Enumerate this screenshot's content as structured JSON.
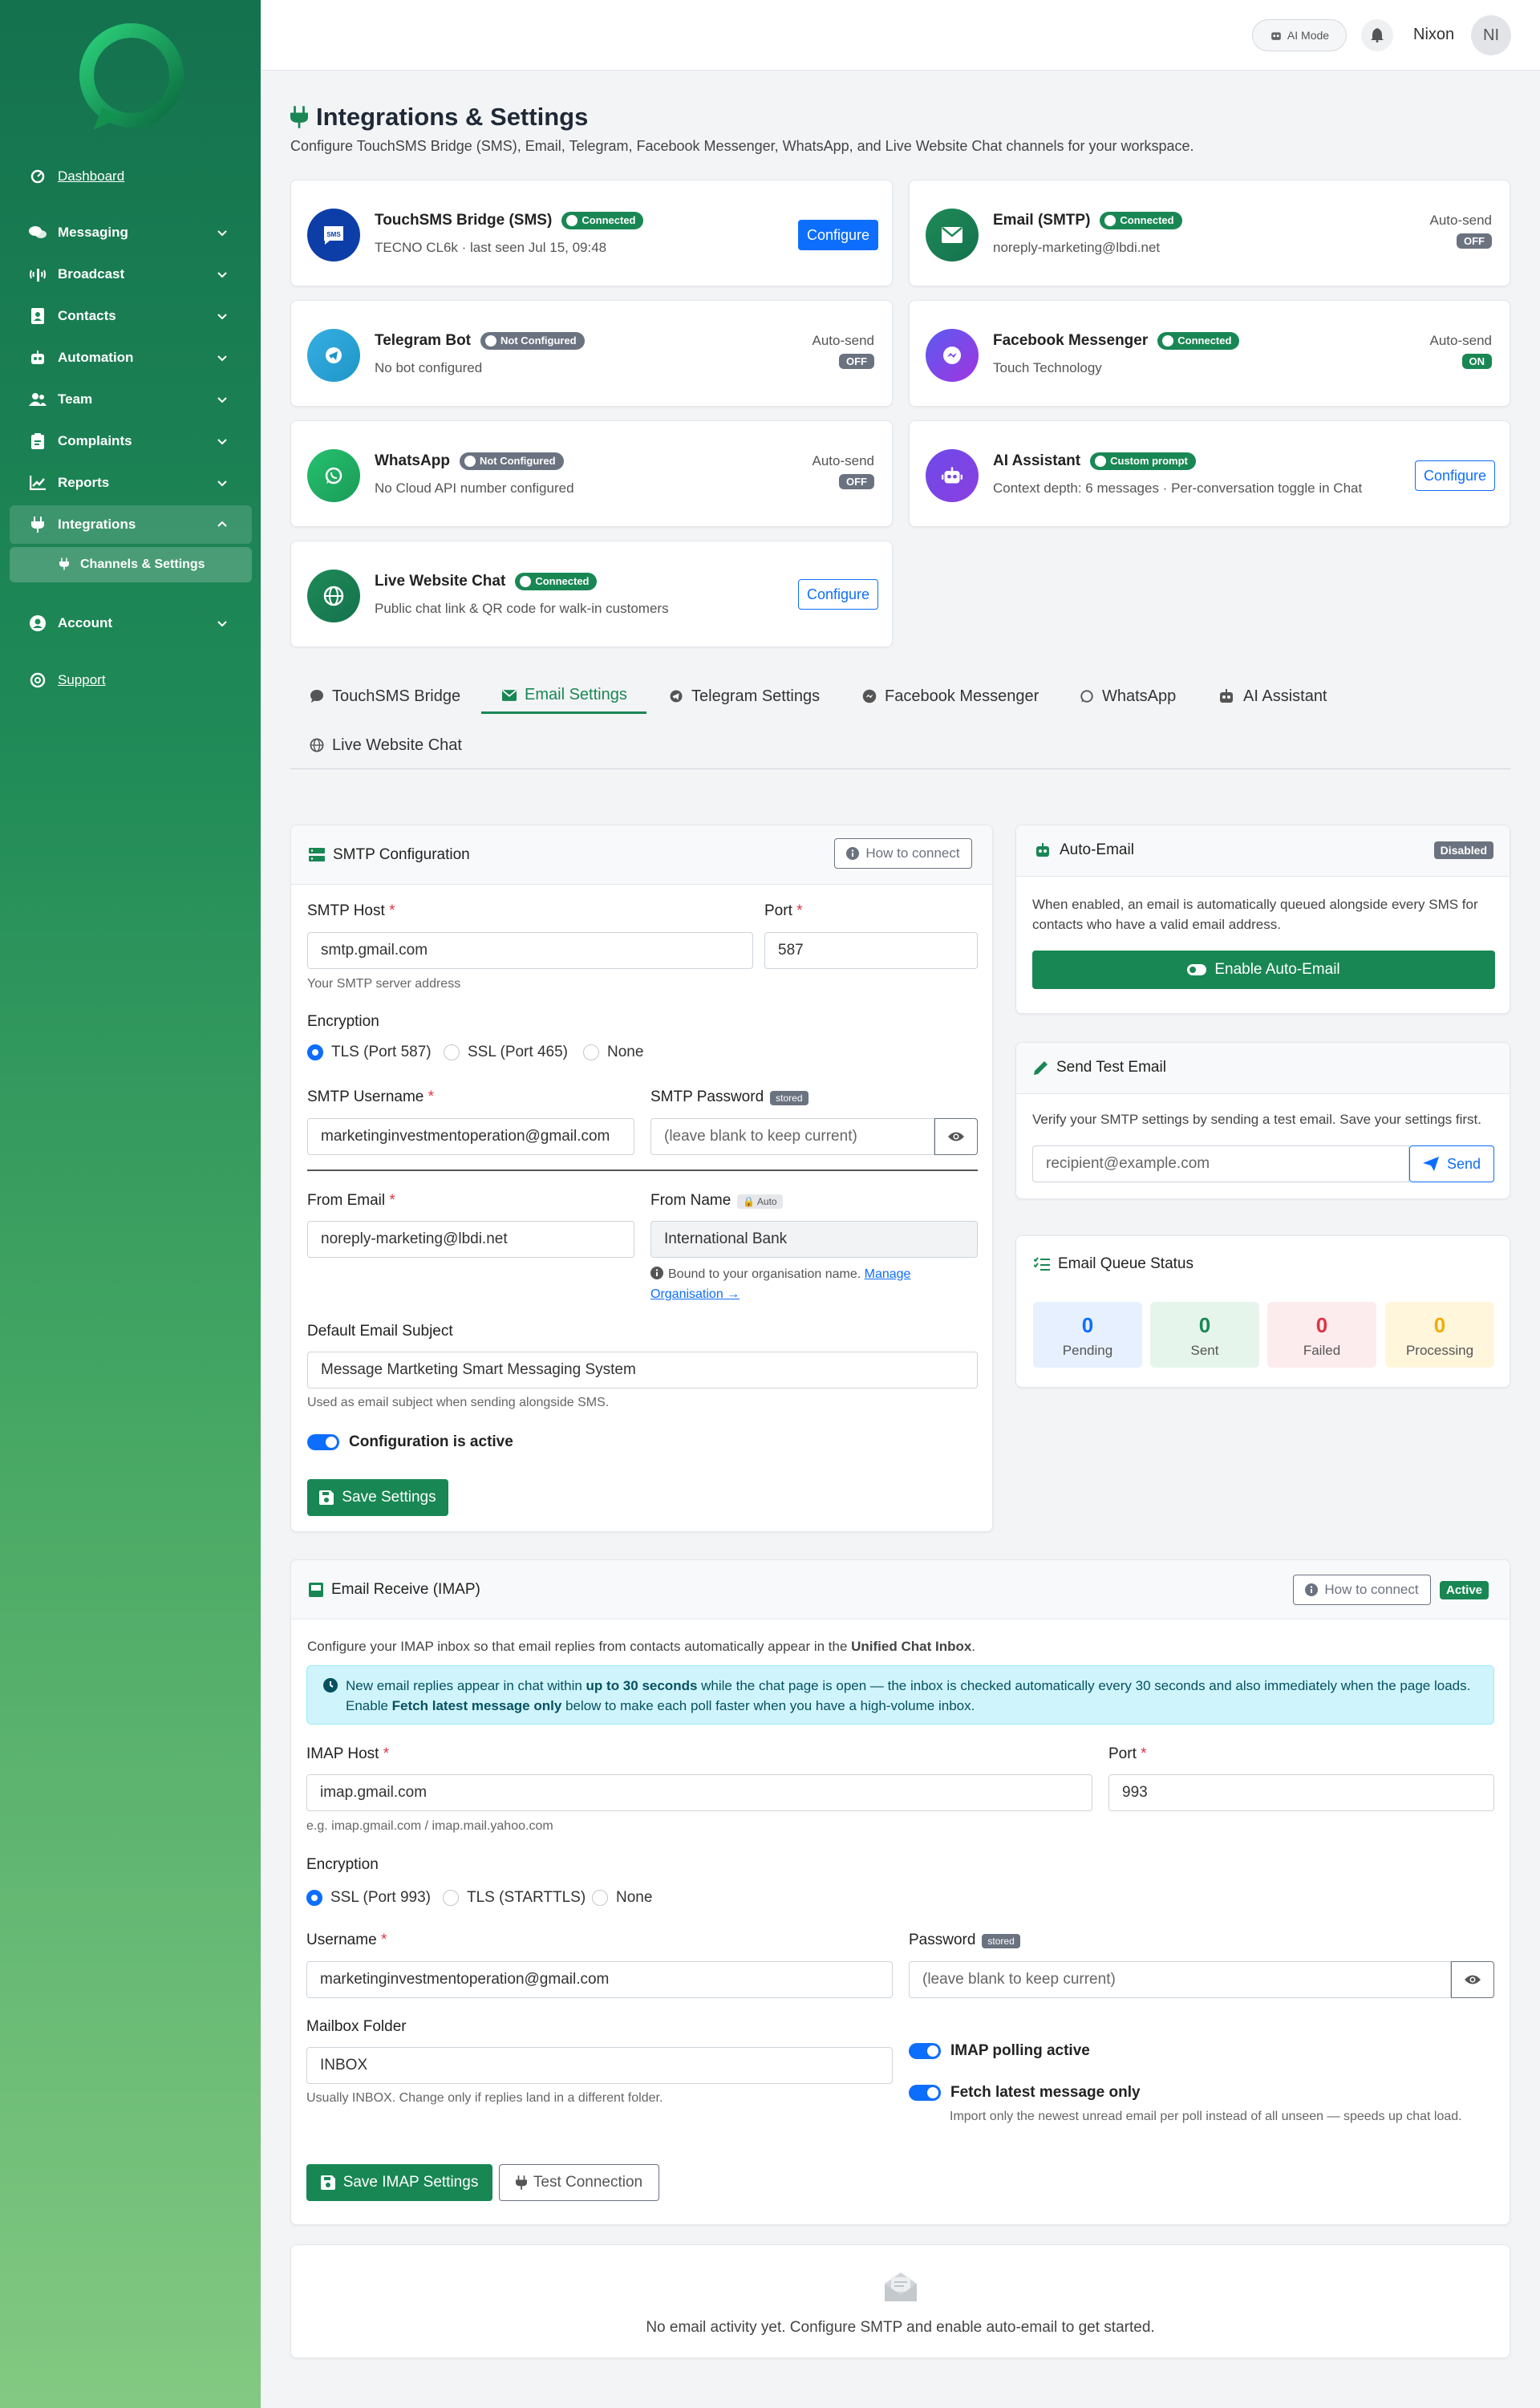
{
  "sidebar": {
    "dashboard": "Dashboard",
    "messaging": "Messaging",
    "broadcast": "Broadcast",
    "contacts": "Contacts",
    "automation": "Automation",
    "team": "Team",
    "complaints": "Complaints",
    "reports": "Reports",
    "integrations": "Integrations",
    "channels_settings": "Channels & Settings",
    "account": "Account",
    "support": "Support"
  },
  "topbar": {
    "ai_mode": "AI Mode",
    "user_name": "Nixon",
    "initials": "NI"
  },
  "page": {
    "title": "Integrations & Settings",
    "subtitle": "Configure TouchSMS Bridge (SMS), Email, Telegram, Facebook Messenger, WhatsApp, and Live Website Chat channels for your workspace."
  },
  "channels": {
    "sms": {
      "name": "TouchSMS Bridge (SMS)",
      "status": "Connected",
      "desc": "TECNO CL6k · last seen Jul 15, 09:48",
      "button": "Configure"
    },
    "email": {
      "name": "Email (SMTP)",
      "status": "Connected",
      "desc": "noreply-marketing@lbdi.net",
      "auto_label": "Auto-send",
      "auto_value": "OFF"
    },
    "telegram": {
      "name": "Telegram Bot",
      "status": "Not Configured",
      "desc": "No bot configured",
      "auto_label": "Auto-send",
      "auto_value": "OFF"
    },
    "facebook": {
      "name": "Facebook Messenger",
      "status": "Connected",
      "desc": "Touch Technology",
      "auto_label": "Auto-send",
      "auto_value": "ON"
    },
    "whatsapp": {
      "name": "WhatsApp",
      "status": "Not Configured",
      "desc": "No Cloud API number configured",
      "auto_label": "Auto-send",
      "auto_value": "OFF"
    },
    "ai": {
      "name": "AI Assistant",
      "status": "Custom prompt",
      "desc": "Context depth: 6 messages · Per-conversation toggle in Chat",
      "button": "Configure"
    },
    "livechat": {
      "name": "Live Website Chat",
      "status": "Connected",
      "desc": "Public chat link & QR code for walk-in customers",
      "button": "Configure"
    }
  },
  "tabs": {
    "sms": "TouchSMS Bridge",
    "email": "Email Settings",
    "telegram": "Telegram Settings",
    "facebook": "Facebook Messenger",
    "whatsapp": "WhatsApp",
    "ai": "AI Assistant",
    "livechat": "Live Website Chat"
  },
  "smtp": {
    "title": "SMTP Configuration",
    "how_to": "How to connect",
    "host_label": "SMTP Host",
    "host_value": "smtp.gmail.com",
    "host_hint": "Your SMTP server address",
    "port_label": "Port",
    "port_value": "587",
    "encryption_label": "Encryption",
    "enc_tls": "TLS (Port 587)",
    "enc_ssl": "SSL (Port 465)",
    "enc_none": "None",
    "username_label": "SMTP Username",
    "username_value": "marketinginvestmentoperation@gmail.com",
    "password_label": "SMTP Password",
    "password_badge": "stored",
    "password_placeholder": "(leave blank to keep current)",
    "from_email_label": "From Email",
    "from_email_value": "noreply-marketing@lbdi.net",
    "from_name_label": "From Name",
    "from_name_badge": "Auto",
    "from_name_value": "International Bank",
    "from_name_hint": "Bound to your organisation name.",
    "from_name_link": "Manage Organisation →",
    "subject_label": "Default Email Subject",
    "subject_value": "Message Martketing Smart Messaging System",
    "subject_hint": "Used as email subject when sending alongside SMS.",
    "active_label": "Configuration is active",
    "save": "Save Settings"
  },
  "auto_email": {
    "title": "Auto-Email",
    "badge": "Disabled",
    "desc": "When enabled, an email is automatically queued alongside every SMS for contacts who have a valid email address.",
    "button": "Enable Auto-Email"
  },
  "test_email": {
    "title": "Send Test Email",
    "desc": "Verify your SMTP settings by sending a test email. Save your settings first.",
    "placeholder": "recipient@example.com",
    "button": "Send"
  },
  "queue": {
    "title": "Email Queue Status",
    "pending_value": "0",
    "pending_label": "Pending",
    "sent_value": "0",
    "sent_label": "Sent",
    "failed_value": "0",
    "failed_label": "Failed",
    "processing_value": "0",
    "processing_label": "Processing"
  },
  "imap": {
    "title": "Email Receive (IMAP)",
    "how_to": "How to connect",
    "badge": "Active",
    "intro_a": "Configure your IMAP inbox so that email replies from contacts automatically appear in the ",
    "intro_b": "Unified Chat Inbox",
    "intro_c": ".",
    "alert_a": "New email replies appear in chat within ",
    "alert_b": "up to 30 seconds",
    "alert_c": " while the chat page is open — the inbox is checked automatically every 30 seconds and also immediately when the page loads. Enable ",
    "alert_d": "Fetch latest message only",
    "alert_e": " below to make each poll faster when you have a high-volume inbox.",
    "host_label": "IMAP Host",
    "host_value": "imap.gmail.com",
    "host_hint": "e.g. imap.gmail.com / imap.mail.yahoo.com",
    "port_label": "Port",
    "port_value": "993",
    "encryption_label": "Encryption",
    "enc_ssl": "SSL (Port 993)",
    "enc_tls": "TLS (STARTTLS)",
    "enc_none": "None",
    "username_label": "Username",
    "username_value": "marketinginvestmentoperation@gmail.com",
    "password_label": "Password",
    "password_badge": "stored",
    "password_placeholder": "(leave blank to keep current)",
    "folder_label": "Mailbox Folder",
    "folder_value": "INBOX",
    "folder_hint": "Usually INBOX. Change only if replies land in a different folder.",
    "polling_label": "IMAP polling active",
    "fetch_label": "Fetch latest message only",
    "fetch_hint": "Import only the newest unread email per poll instead of all unseen — speeds up chat load.",
    "save": "Save IMAP Settings",
    "test": "Test Connection"
  },
  "empty": {
    "text": "No email activity yet. Configure SMTP and enable auto-email to get started."
  },
  "colors": {
    "brand_green": "#198754",
    "primary_blue": "#0d6efd",
    "sidebar_top": "#14724e",
    "sidebar_bottom": "#83c982"
  }
}
